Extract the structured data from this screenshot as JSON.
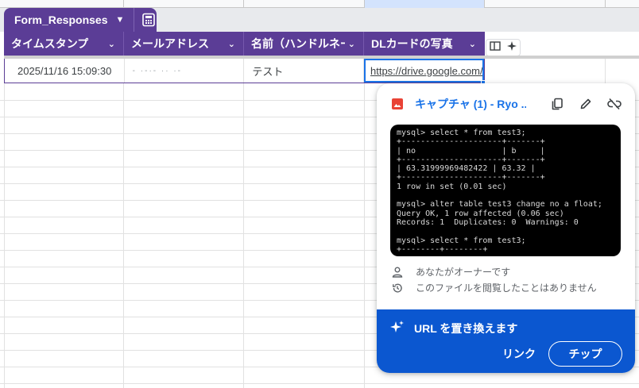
{
  "table": {
    "name": "Form_Responses",
    "columns": [
      "タイムスタンプ",
      "メールアドレス",
      "名前（ハンドルネーム）",
      "DLカードの写真"
    ],
    "row": {
      "timestamp": "2025/11/16 15:09:30",
      "email": "- ·-·- ·· ·-",
      "name": "テスト",
      "link": "https://drive.google.com/open"
    }
  },
  "popup": {
    "file_title": "キャプチャ (1) - Ryo ...",
    "terminal_lines": [
      "mysql> select * from test3;",
      "+---------------------+-------+",
      "| no                  | b     |",
      "+---------------------+-------+",
      "| 63.31999969482422 | 63.32 |",
      "+---------------------+-------+",
      "1 row in set (0.01 sec)",
      "",
      "mysql> alter table test3 change no a float;",
      "Query OK, 1 row affected (0.06 sec)",
      "Records: 1  Duplicates: 0  Warnings: 0",
      "",
      "mysql> select * from test3;",
      "+--------+--------+"
    ],
    "owner_text": "あなたがオーナーです",
    "viewed_text": "このファイルを閲覧したことはありません",
    "replace_text": "URL を置き換えます",
    "link_button": "リンク",
    "chip_button": "チップ"
  },
  "icons": {
    "table_calc": "calculator-icon",
    "header_tool_1": "column-split-icon",
    "header_tool_2": "sparkle-icon",
    "file": "image-file-icon",
    "copy": "copy-icon",
    "edit": "pencil-icon",
    "unlink": "unlink-icon",
    "owner": "person-icon",
    "history": "history-icon",
    "spark": "sparkle-icon"
  },
  "colors": {
    "table_header": "#5b3d96",
    "link_blue": "#1a73e8",
    "action_panel": "#0b57d0",
    "file_icon": "#e94235"
  }
}
